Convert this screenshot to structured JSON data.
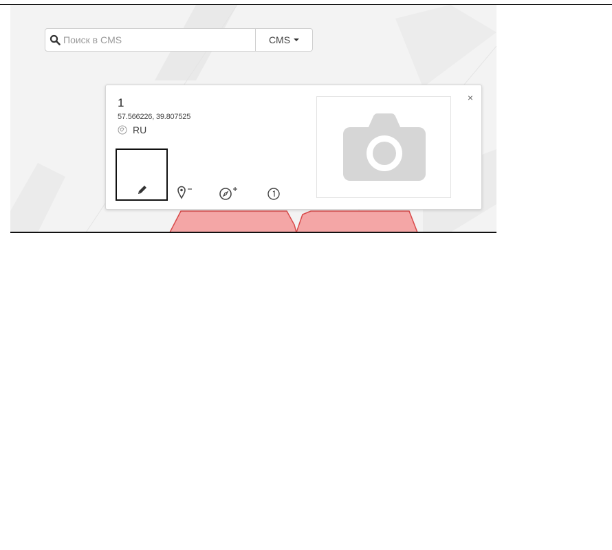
{
  "search": {
    "placeholder": "Поиск в CMS",
    "dropdown_label": "CMS"
  },
  "popup": {
    "title": "1",
    "coordinates": "57.566226, 39.807525",
    "country": "RU",
    "close_label": "×"
  },
  "icons": {
    "search": "search-icon",
    "globe": "globe-icon",
    "close": "close-icon",
    "edit": "pencil-icon",
    "pin_minus": "map-pin-minus-icon",
    "compass_plus": "compass-plus-icon",
    "info": "info-circle-icon",
    "photo": "camera-icon"
  },
  "colors": {
    "map_background": "#f3f3f3",
    "polygon_fill": "#f4a6a6",
    "polygon_stroke": "#d84a4a",
    "camera": "#d6d6d6"
  }
}
